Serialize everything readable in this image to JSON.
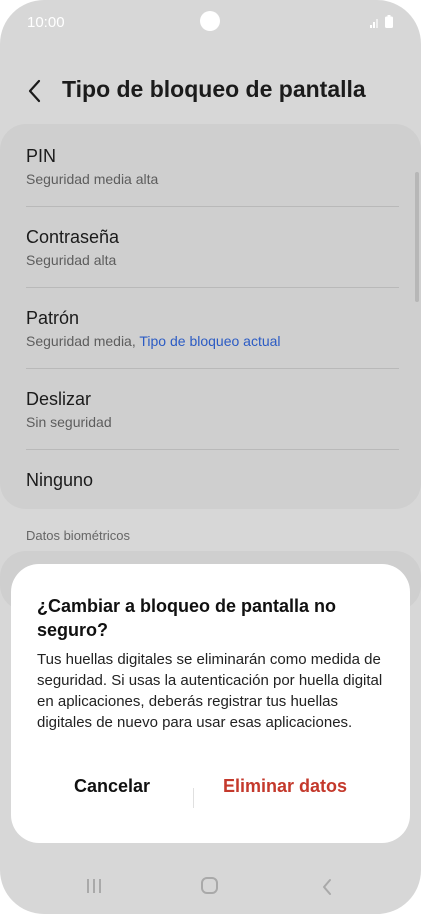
{
  "status_bar": {
    "time": "10:00"
  },
  "header": {
    "title": "Tipo de bloqueo de pantalla"
  },
  "options": [
    {
      "title": "PIN",
      "subtitle": "Seguridad media alta",
      "current": ""
    },
    {
      "title": "Contraseña",
      "subtitle": "Seguridad alta",
      "current": ""
    },
    {
      "title": "Patrón",
      "subtitle": "Seguridad media, ",
      "current": "Tipo de bloqueo actual"
    },
    {
      "title": "Deslizar",
      "subtitle": "Sin seguridad",
      "current": ""
    },
    {
      "title": "Ninguno",
      "subtitle": "",
      "current": ""
    }
  ],
  "biometrics_section": {
    "label": "Datos biométricos"
  },
  "dialog": {
    "title": "¿Cambiar a bloqueo de pantalla no seguro?",
    "body": "Tus huellas digitales se eliminarán como medida de seguridad. Si usas la autenticación por huella digital en aplicaciones, deberás registrar tus huellas digitales de nuevo para usar esas aplicaciones.",
    "cancel_label": "Cancelar",
    "confirm_label": "Eliminar datos"
  },
  "icons": {
    "back": "chevron-left-icon",
    "signal": "signal-icon",
    "battery": "battery-icon",
    "nav_recent": "recent-apps-icon",
    "nav_home": "home-icon",
    "nav_back": "nav-back-icon"
  },
  "colors": {
    "current_lock_link": "#2b5bc4",
    "destructive_action": "#c4392c",
    "scrim_background": "#d7d7d7",
    "dialog_background": "#ffffff"
  }
}
